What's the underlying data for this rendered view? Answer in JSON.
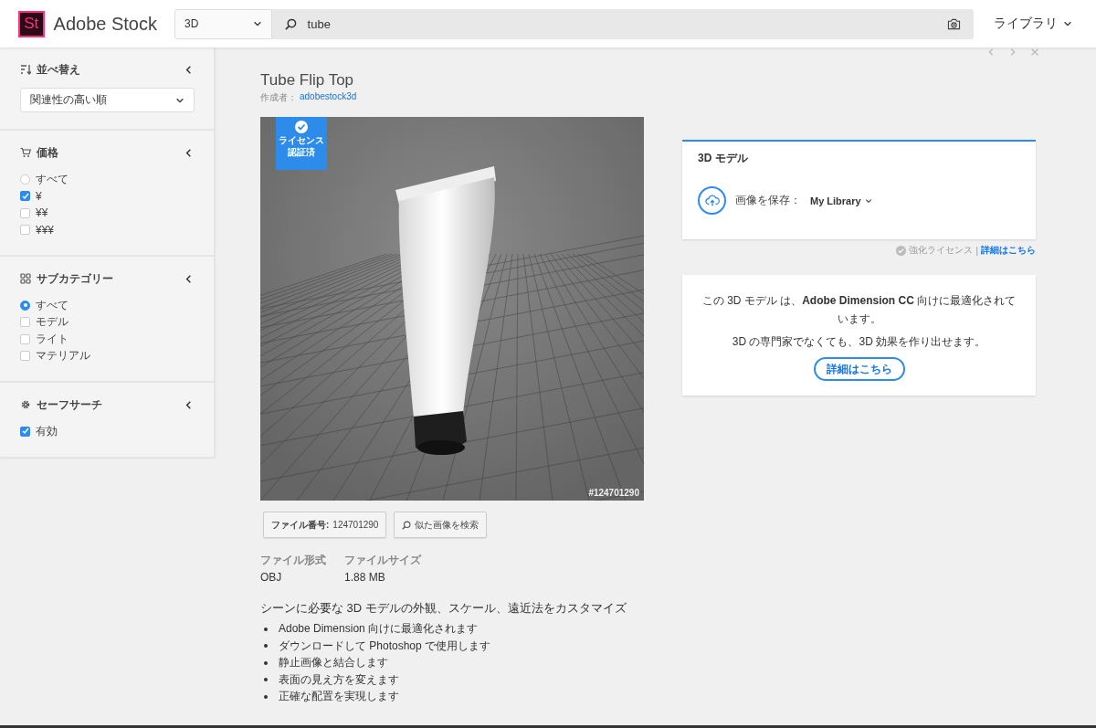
{
  "header": {
    "logo_mark": "St",
    "logo_text": "Adobe Stock",
    "category": "3D",
    "search": "tube",
    "library": "ライブラリ"
  },
  "sidebar": {
    "sections": [
      {
        "kind": "sort",
        "title": "並べ替え",
        "dropdown": "関連性の高い順"
      },
      {
        "kind": "price",
        "title": "価格",
        "options": [
          {
            "kind": "radio",
            "label": "すべて",
            "checked": false
          },
          {
            "kind": "checkbox",
            "label": "¥",
            "checked": true
          },
          {
            "kind": "checkbox",
            "label": "¥¥",
            "checked": false
          },
          {
            "kind": "checkbox",
            "label": "¥¥¥",
            "checked": false
          }
        ]
      },
      {
        "kind": "subcategory",
        "title": "サブカテゴリー",
        "options": [
          {
            "kind": "radio",
            "label": "すべて",
            "checked": true
          },
          {
            "kind": "checkbox",
            "label": "モデル",
            "checked": false
          },
          {
            "kind": "checkbox",
            "label": "ライト",
            "checked": false
          },
          {
            "kind": "checkbox",
            "label": "マテリアル",
            "checked": false
          }
        ]
      },
      {
        "kind": "safesearch",
        "title": "セーフサーチ",
        "options": [
          {
            "kind": "checkbox",
            "label": "有効",
            "checked": true
          }
        ]
      }
    ]
  },
  "asset": {
    "title": "Tube Flip Top",
    "author_label": "作成者：",
    "author": "adobestock3d",
    "badge": "ライセンス認証済",
    "image_id": "#124701290",
    "file_number_label": "ファイル番号:",
    "file_number": "124701290",
    "similar": "似た画像を検索",
    "meta": [
      {
        "label": "ファイル形式",
        "value": "OBJ"
      },
      {
        "label": "ファイルサイズ",
        "value": "1.88 MB"
      }
    ],
    "features_title": "シーンに必要な 3D モデルの外観、スケール、遠近法をカスタマイズ",
    "features": [
      "Adobe Dimension 向けに最適化されます",
      "ダウンロードして Photoshop で使用します",
      "静止画像と結合します",
      "表面の見え方を変えます",
      "正確な配置を実現します"
    ]
  },
  "license_card": {
    "title": "3D モデル",
    "save_label": "画像を保存：",
    "library": "My Library"
  },
  "license_note": {
    "text": "強化ライセンス",
    "separator": "|",
    "link": "詳細はこちら"
  },
  "dimension_card": {
    "text": "この 3D モデル は、**Adobe Dimension CC** 向けに最適化されています。",
    "text2": "3D の専門家でなくても、3D 効果を作り出せます。",
    "button": "詳細はこちら"
  }
}
